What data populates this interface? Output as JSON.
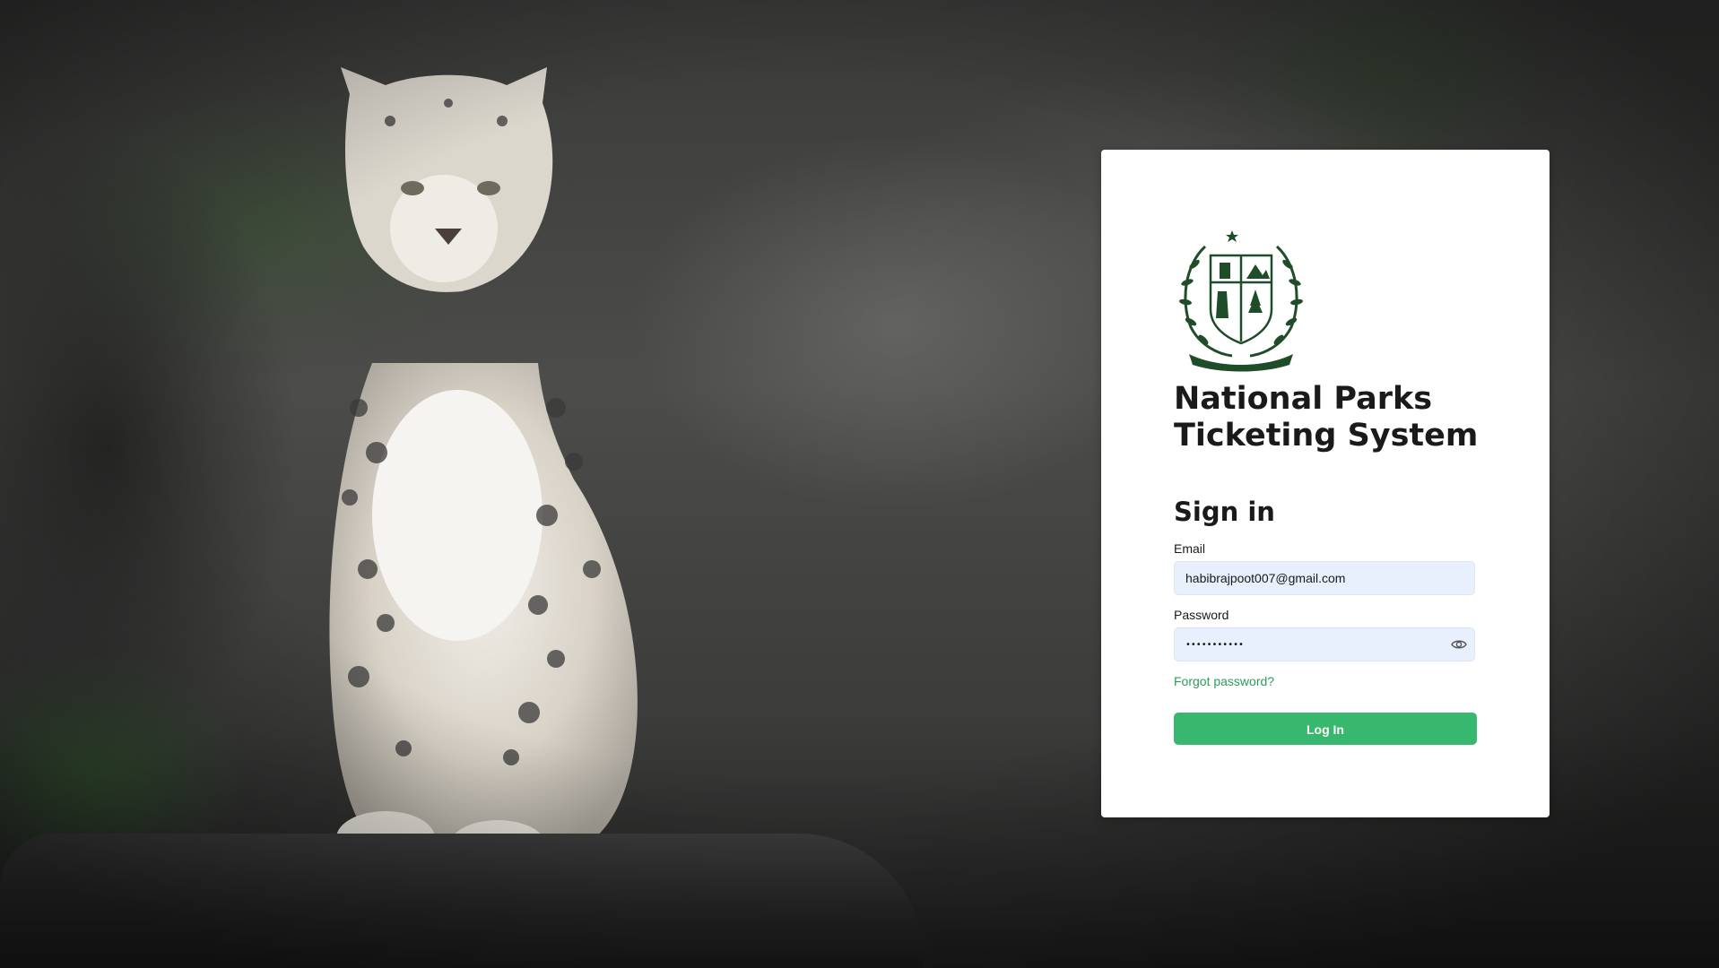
{
  "background": {
    "subject": "snow-leopard-on-rock"
  },
  "emblem": {
    "icon": "government-emblem-icon",
    "color": "#1f4d2a"
  },
  "app": {
    "title_line1": "National Parks",
    "title_line2": "Ticketing System"
  },
  "form": {
    "heading": "Sign in",
    "email_label": "Email",
    "email_value": "habibrajpoot007@gmail.com",
    "password_label": "Password",
    "password_value": "•••••••••••",
    "password_toggle_icon": "eye-icon",
    "forgot_password": "Forgot password?",
    "login_button": "Log In"
  },
  "colors": {
    "accent_green": "#38b86e",
    "link_green": "#2e9b5c",
    "input_bg": "#e8f0fe"
  }
}
